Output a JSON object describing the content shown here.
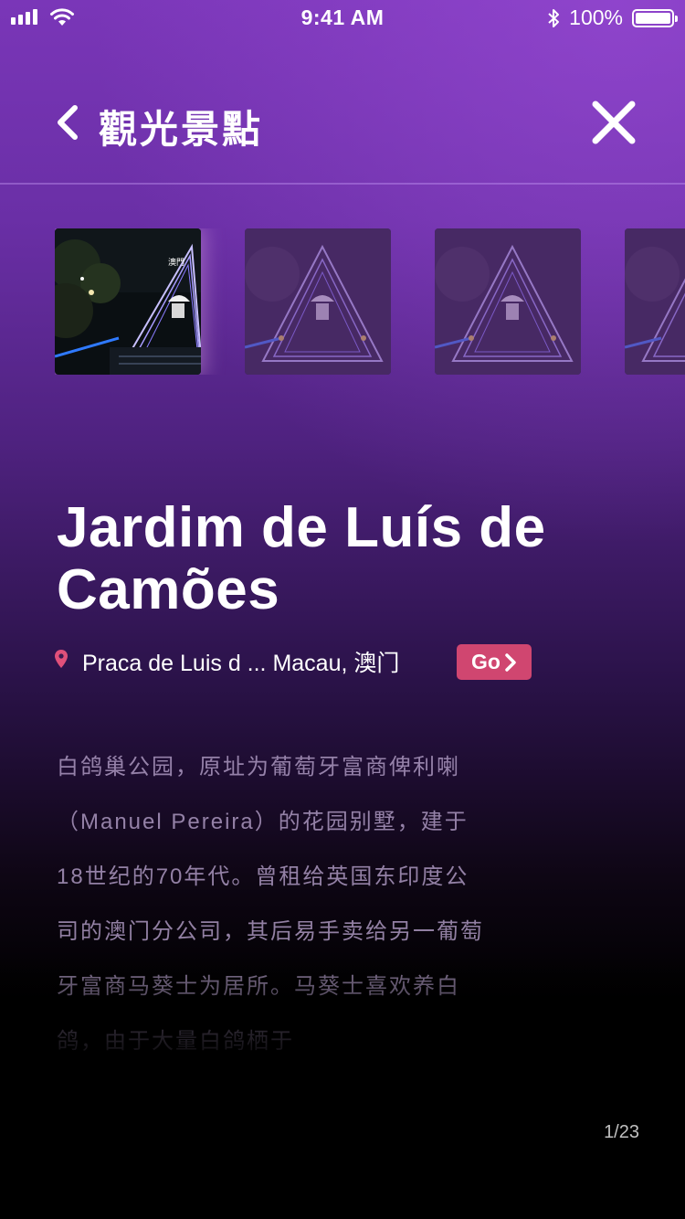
{
  "status_bar": {
    "time": "9:41 AM",
    "battery_text": "100%",
    "battery_level": 1.0,
    "signal_bars": 4,
    "icons": [
      "signal-icon",
      "wifi-icon",
      "bluetooth-icon",
      "battery-icon"
    ]
  },
  "header": {
    "title": "觀光景點",
    "back_icon": "chevron-left-icon",
    "close_icon": "close-icon"
  },
  "gallery": {
    "items": [
      {
        "selected": true
      },
      {
        "selected": false
      },
      {
        "selected": false
      },
      {
        "selected": false
      }
    ]
  },
  "place": {
    "name": "Jardim de Luís de Camões",
    "address": "Praca de Luis d ... Macau, 澳门",
    "go_label": "Go",
    "description": "白鸽巢公园，原址为葡萄牙富商俾利喇（Manuel Pereira）的花园别墅，建于18世纪的70年代。曾租给英国东印度公司的澳门分公司，其后易手卖给另一葡萄牙富商马葵士为居所。马葵士喜欢养白鸽，由于大量白鸽栖于"
  },
  "pager": {
    "text": "1/23"
  },
  "colors": {
    "accent": "#d04670",
    "pin": "#e0507a",
    "bg_top": "#7a36b8",
    "bg_bottom": "#000000"
  }
}
